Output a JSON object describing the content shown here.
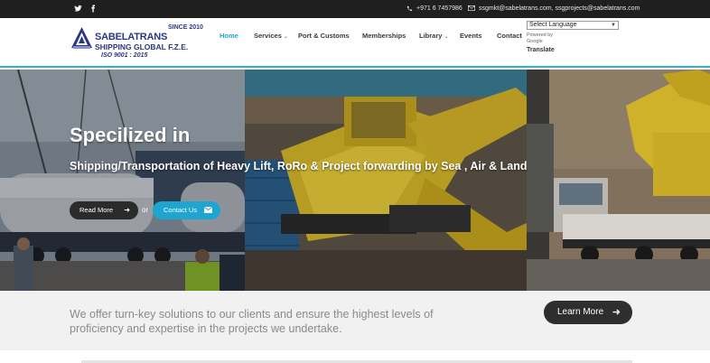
{
  "topbar": {
    "social": [
      {
        "icon": "twitter-icon",
        "glyph": "𝕥"
      },
      {
        "icon": "facebook-icon",
        "glyph": "f"
      }
    ],
    "phone": "+971 6 7457986",
    "email": "ssgmkt@sabelatrans.com, ssgprojects@sabelatrans.com"
  },
  "logo": {
    "since": "SINCE 2010",
    "name": "SABELATRANS",
    "sub": "SHIPPING GLOBAL F.Z.E.",
    "iso": "ISO 9001 : 2015"
  },
  "nav": {
    "items": [
      {
        "label": "Home",
        "active": true
      },
      {
        "label": "Services",
        "dropdown": true
      },
      {
        "label": "Port & Customs"
      },
      {
        "label": "Memberships"
      },
      {
        "label": "Library",
        "dropdown": true
      },
      {
        "label": "Events"
      },
      {
        "label": "Contact"
      }
    ]
  },
  "translate": {
    "select_value": "Select Language",
    "powered_by": "Powered by",
    "google": "Google",
    "label": "Translate"
  },
  "hero": {
    "title": "Specilized in",
    "subtitle": "Shipping/Transportation of Heavy Lift, RoRo & Project forwarding by Sea , Air & Land",
    "read_more": "Read More",
    "or": "or",
    "contact_us": "Contact Us"
  },
  "offer": {
    "text": "We offer turn-key solutions to our clients and ensure the highest levels of proficiency and expertise in the projects we undertake.",
    "learn_more": "Learn More"
  },
  "colors": {
    "accent": "#1fa6d0",
    "topbar": "#1f1f1f",
    "brand": "#2a3880",
    "dark_button": "#2e2e2e"
  }
}
